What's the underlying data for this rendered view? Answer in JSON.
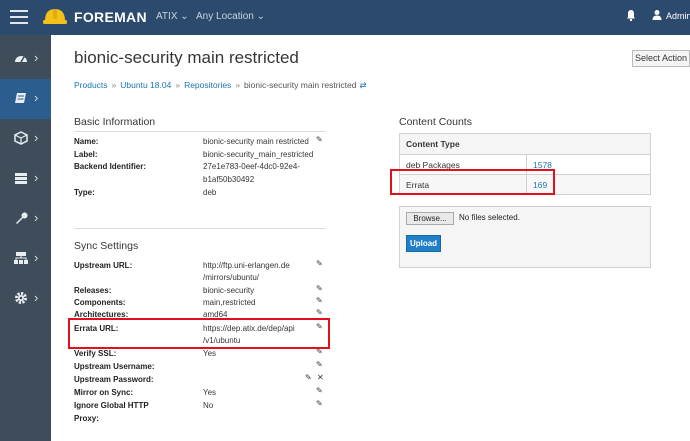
{
  "header": {
    "brand": "FOREMAN",
    "organization": "ATIX",
    "location": "Any Location",
    "user": "Admin",
    "icons": [
      "menu-icon",
      "bell-icon",
      "user-icon"
    ]
  },
  "sidenav": {
    "items": [
      {
        "icon": "dashboard-icon"
      },
      {
        "icon": "content-icon",
        "active": true
      },
      {
        "icon": "hosts-icon"
      },
      {
        "icon": "configure-icon"
      },
      {
        "icon": "wrench-icon"
      },
      {
        "icon": "infrastructure-icon"
      },
      {
        "icon": "gear-icon"
      }
    ]
  },
  "page": {
    "title": "bionic-security main restricted",
    "select_action": "Select Action"
  },
  "breadcrumb": {
    "items": [
      "Products",
      "Ubuntu 18.04",
      "Repositories",
      "bionic-security main restricted"
    ],
    "separator": "»"
  },
  "basic": {
    "heading": "Basic Information",
    "name_label": "Name:",
    "name_value": "bionic-security main restricted",
    "label_label": "Label:",
    "label_value": "bionic-security_main_restricted",
    "backend_label": "Backend Identifier:",
    "backend_value_1": "27e1e783-0eef-4dc0-92e4-",
    "backend_value_2": "b1af50b30492",
    "type_label": "Type:",
    "type_value": "deb"
  },
  "sync": {
    "heading": "Sync Settings",
    "upstream_label": "Upstream URL:",
    "upstream_value_1": "http://ftp.uni-erlangen.de",
    "upstream_value_2": "/mirrors/ubuntu/",
    "releases_label": "Releases:",
    "releases_value": "bionic-security",
    "components_label": "Components:",
    "components_value": "main,restricted",
    "arch_label": "Architectures:",
    "arch_value": "amd64",
    "errata_label": "Errata URL:",
    "errata_value_1": "https://dep.atix.de/dep/api",
    "errata_value_2": "/v1/ubuntu",
    "verify_label": "Verify SSL:",
    "verify_value": "Yes",
    "username_label": "Upstream Username:",
    "password_label": "Upstream Password:",
    "mirror_label": "Mirror on Sync:",
    "mirror_value": "Yes",
    "ignore_label_1": "Ignore Global HTTP",
    "ignore_label_2": "Proxy:",
    "ignore_value": "No"
  },
  "counts": {
    "heading": "Content Counts",
    "column": "Content Type",
    "rows": [
      {
        "type": "deb Packages",
        "count": "1578"
      },
      {
        "type": "Errata",
        "count": "169"
      }
    ]
  },
  "upload": {
    "browse": "Browse...",
    "no_file": "No files selected.",
    "button": "Upload"
  },
  "colors": {
    "topbar": "#2b4a6e",
    "sidenav": "#3f4d5b",
    "active": "#2b5d8f",
    "link": "#1a76b3",
    "highlight": "#e0101e",
    "primary": "#1f7fc7"
  }
}
